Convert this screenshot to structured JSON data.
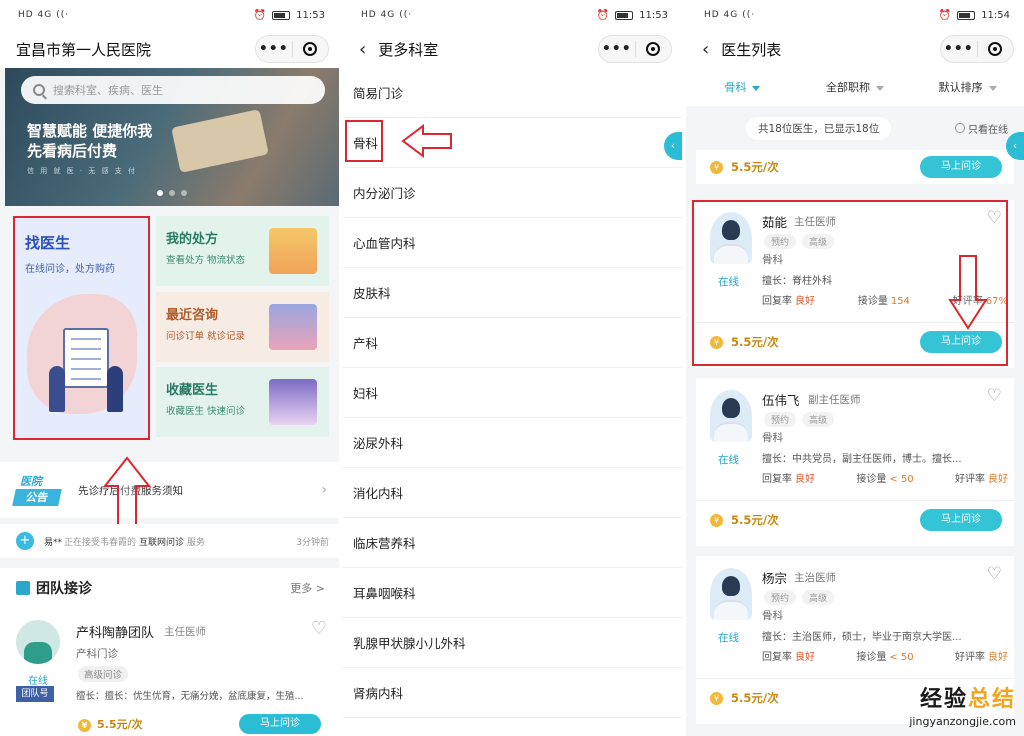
{
  "status_bars": [
    {
      "net": "HD 4G",
      "time": "11:53"
    },
    {
      "net": "HD 4G",
      "time": "11:53"
    },
    {
      "net": "HD 4G",
      "time": "11:54"
    }
  ],
  "screen1": {
    "title": "宜昌市第一人民医院",
    "capsule_more": "•••",
    "search_placeholder": "搜索科室、疾病、医生",
    "banner": {
      "slogan_line1": "智慧赋能 便捷你我",
      "slogan_line2": "先看病后付费",
      "subline": "信 用 就 医 · 无 感 支 付"
    },
    "find_doctor": {
      "title": "找医生",
      "subtitle": "在线问诊，处方购药"
    },
    "prescription": {
      "title": "我的处方",
      "subtitle": "查看处方 物流状态"
    },
    "recent": {
      "title": "最近咨询",
      "subtitle": "问诊订单 就诊记录"
    },
    "favorites": {
      "title": "收藏医生",
      "subtitle": "收藏医生 快速问诊"
    },
    "notice": {
      "badge_top": "医院",
      "badge_bottom": "公告",
      "text": "先诊疗后付费服务须知"
    },
    "ticker": {
      "user": "易**",
      "middle": "正在接受韦春霞的",
      "service": "互联网问诊",
      "suffix": "服务",
      "time": "3分钟前"
    },
    "team": {
      "header": "团队接诊",
      "more": "更多 >",
      "name": "产科陶静团队",
      "level": "主任医师",
      "dept": "产科门诊",
      "tag": "高级问诊",
      "specialty": "擅长：擅长：优生优育，无痛分娩，盆底康复，生殖...",
      "online": "在线",
      "team_id": "团队号",
      "price": "5.5元/次",
      "ask": "马上问诊"
    }
  },
  "screen2": {
    "title": "更多科室",
    "departments": [
      "简易门诊",
      "骨科",
      "内分泌门诊",
      "心血管内科",
      "皮肤科",
      "产科",
      "妇科",
      "泌尿外科",
      "消化内科",
      "临床营养科",
      "耳鼻咽喉科",
      "乳腺甲状腺小儿外科",
      "肾病内科"
    ]
  },
  "screen3": {
    "title": "医生列表",
    "filters": [
      "骨科",
      "全部职称",
      "默认排序"
    ],
    "summary": "共18位医生，已显示18位",
    "only_online": "只看在线",
    "top_price": "5.5元/次",
    "ask": "马上问诊",
    "doctors": [
      {
        "name": "茹能",
        "title": "主任医师",
        "tags": [
          "预约",
          "高级"
        ],
        "dept": "骨科",
        "specialty": "擅长：脊柱外科",
        "online": "在线",
        "reply_label": "回复率",
        "reply": "良好",
        "count_label": "接诊量",
        "count": "154",
        "rating_label": "好评率",
        "rating": "67%",
        "price": "5.5元/次"
      },
      {
        "name": "伍伟飞",
        "title": "副主任医师",
        "tags": [
          "预约",
          "高级"
        ],
        "dept": "骨科",
        "specialty": "擅长：中共党员，副主任医师，博士。擅长...",
        "online": "在线",
        "reply_label": "回复率",
        "reply": "良好",
        "count_label": "接诊量",
        "count": "< 50",
        "rating_label": "好评率",
        "rating": "良好",
        "price": "5.5元/次"
      },
      {
        "name": "杨宗",
        "title": "主治医师",
        "tags": [
          "预约",
          "高级"
        ],
        "dept": "骨科",
        "specialty": "擅长：主治医师，硕士，毕业于南京大学医...",
        "online": "在线",
        "reply_label": "回复率",
        "reply": "良好",
        "count_label": "接诊量",
        "count": "< 50",
        "rating_label": "好评率",
        "rating": "良好",
        "price": "5.5元/次"
      }
    ]
  },
  "watermark": {
    "line1_a": "经验",
    "line1_b": "总结",
    "line2": "jingyanzongjie.com"
  },
  "colors": {
    "accent": "#2cbdd6",
    "highlight": "#d9282f",
    "price": "#c8880f"
  }
}
